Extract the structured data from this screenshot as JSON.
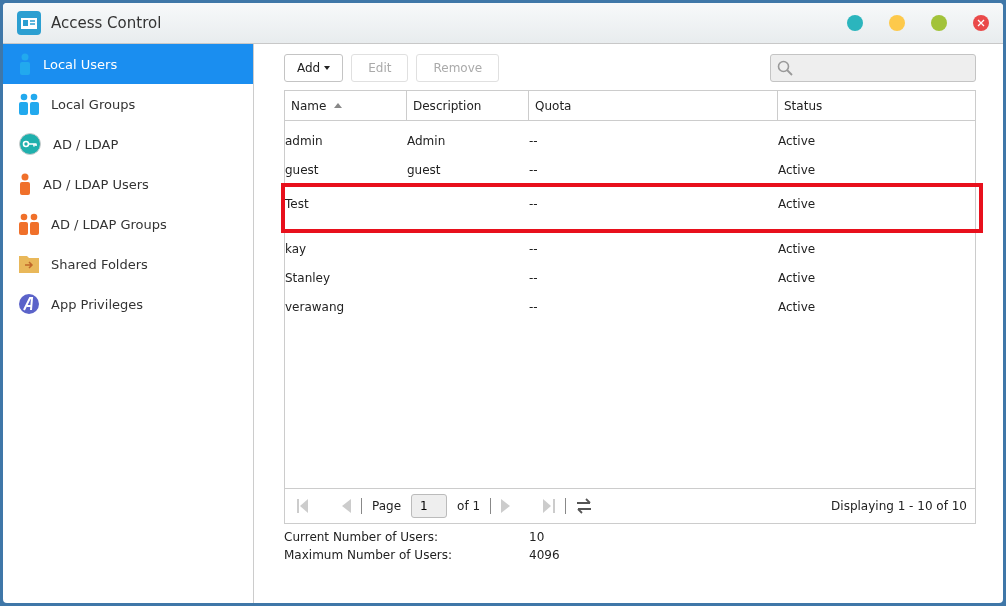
{
  "window": {
    "title": "Access Control",
    "controls": [
      {
        "kind": "teal"
      },
      {
        "kind": "yellow"
      },
      {
        "kind": "green"
      },
      {
        "kind": "close"
      }
    ]
  },
  "sidebar": {
    "items": [
      {
        "label": "Local Users",
        "kind": "user",
        "selected": true
      },
      {
        "label": "Local Groups",
        "kind": "group",
        "selected": false
      },
      {
        "label": "AD / LDAP",
        "kind": "key",
        "selected": false
      },
      {
        "label": "AD / LDAP Users",
        "kind": "aduser",
        "selected": false
      },
      {
        "label": "AD / LDAP Groups",
        "kind": "adgroup",
        "selected": false
      },
      {
        "label": "Shared Folders",
        "kind": "folder",
        "selected": false
      },
      {
        "label": "App Privileges",
        "kind": "app",
        "selected": false
      }
    ]
  },
  "toolbar": {
    "buttons": [
      {
        "label": "Add",
        "disabled": false,
        "menu": true
      },
      {
        "label": "Edit",
        "disabled": true,
        "menu": false
      },
      {
        "label": "Remove",
        "disabled": true,
        "menu": false
      }
    ]
  },
  "table": {
    "columns": [
      {
        "label": "Name",
        "sorted": true
      },
      {
        "label": "Description",
        "sorted": false
      },
      {
        "label": "Quota",
        "sorted": false
      },
      {
        "label": "Status",
        "sorted": false
      }
    ],
    "rows": [
      {
        "cells": [
          "admin",
          "Admin",
          "--",
          "Active"
        ],
        "highlighted": false
      },
      {
        "cells": [
          "guest",
          "guest",
          "--",
          "Active"
        ],
        "highlighted": false
      },
      {
        "cells": [
          "Test",
          "",
          "--",
          "Active"
        ],
        "highlighted": true
      },
      {
        "cells": [
          "kay",
          "",
          "--",
          "Active"
        ],
        "highlighted": false
      },
      {
        "cells": [
          "Stanley",
          "",
          "--",
          "Active"
        ],
        "highlighted": false
      },
      {
        "cells": [
          "verawang",
          "",
          "--",
          "Active"
        ],
        "highlighted": false
      }
    ]
  },
  "pager": {
    "page_label": "Page",
    "page": "1",
    "of": "of 1",
    "display": "Displaying 1 - 10 of 10"
  },
  "summary": [
    {
      "label": "Current Number of Users:",
      "value": "10"
    },
    {
      "label": "Maximum Number of Users:",
      "value": "4096"
    }
  ]
}
